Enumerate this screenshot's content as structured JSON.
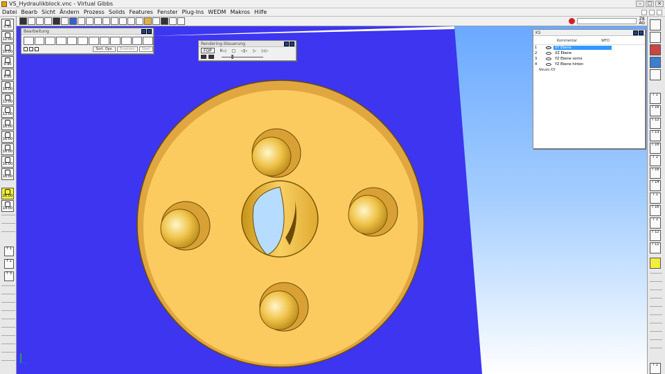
{
  "window": {
    "title": "VS_Hydraulikblock.vnc - Virtual Gibbs",
    "buttons": [
      "–",
      "□",
      "×"
    ]
  },
  "menu": [
    "Datei",
    "Bearb",
    "Sicht",
    "Ändern",
    "Prozess",
    "Solids",
    "Features",
    "Fenster",
    "Plug-Ins",
    "WEDM",
    "Makros",
    "Hilfe"
  ],
  "toolbar": {
    "status_top": "Z8",
    "status_bottom": "AG",
    "right_top": "VS"
  },
  "bearbeitung": {
    "title": "Bearbeitung",
    "sort_button": "Sort. Ops.",
    "ersetzen_button": "Ersetzen",
    "start_button": "Start"
  },
  "rendering": {
    "title": "Rendering-Steuerung",
    "mode": "FOP",
    "controls": [
      "K◁",
      "□",
      "◁▷",
      "▷",
      "▷▷"
    ]
  },
  "ks": {
    "title": "KS",
    "col_comment": "Kommentar",
    "col_wfo": "WFO",
    "rows": [
      {
        "num": "1",
        "name": "XY Ebene",
        "selected": true
      },
      {
        "num": "2",
        "name": "XZ Ebene",
        "selected": false
      },
      {
        "num": "3",
        "name": "YZ Ebene vorne",
        "selected": false
      },
      {
        "num": "4",
        "name": "YZ Ebene hinten",
        "selected": false
      }
    ],
    "new_label": "Neues KS"
  },
  "left_tools": [
    {
      "n": "1",
      "label": "0.50"
    },
    {
      "n": "2",
      "label": "12.00"
    },
    {
      "n": "3",
      "label": "16.00"
    },
    {
      "n": "4",
      "label": "0.90"
    },
    {
      "n": "5",
      "label": "8.00"
    },
    {
      "n": "6",
      "label": "16.00"
    },
    {
      "n": "7",
      "label": "12.00"
    },
    {
      "n": "8",
      "label": "12.00"
    },
    {
      "n": "9",
      "label": "16.00"
    },
    {
      "n": "10",
      "label": "16.00"
    },
    {
      "n": "11",
      "label": "16.00"
    },
    {
      "n": "12",
      "label": "16.00"
    },
    {
      "n": "13",
      "label": "16.00"
    },
    {
      "n": "14",
      "label": "26.00"
    },
    {
      "n": "15",
      "label": "14.00"
    }
  ],
  "lower_left_tools": [
    "T 1",
    "T 2",
    "T 3"
  ],
  "right_tools": [
    "T 1",
    "T 16",
    "T 12",
    "T 13",
    "T 16",
    "T 1",
    "T 16",
    "T 14",
    "T 1",
    "T 16",
    "T 1",
    "T 12",
    "T 11",
    "T 1"
  ],
  "colors": {
    "part": "#f7c85a",
    "part_edge": "#8a6410",
    "plane": "#3d35f0",
    "sky_top": "#6aa9ff"
  }
}
